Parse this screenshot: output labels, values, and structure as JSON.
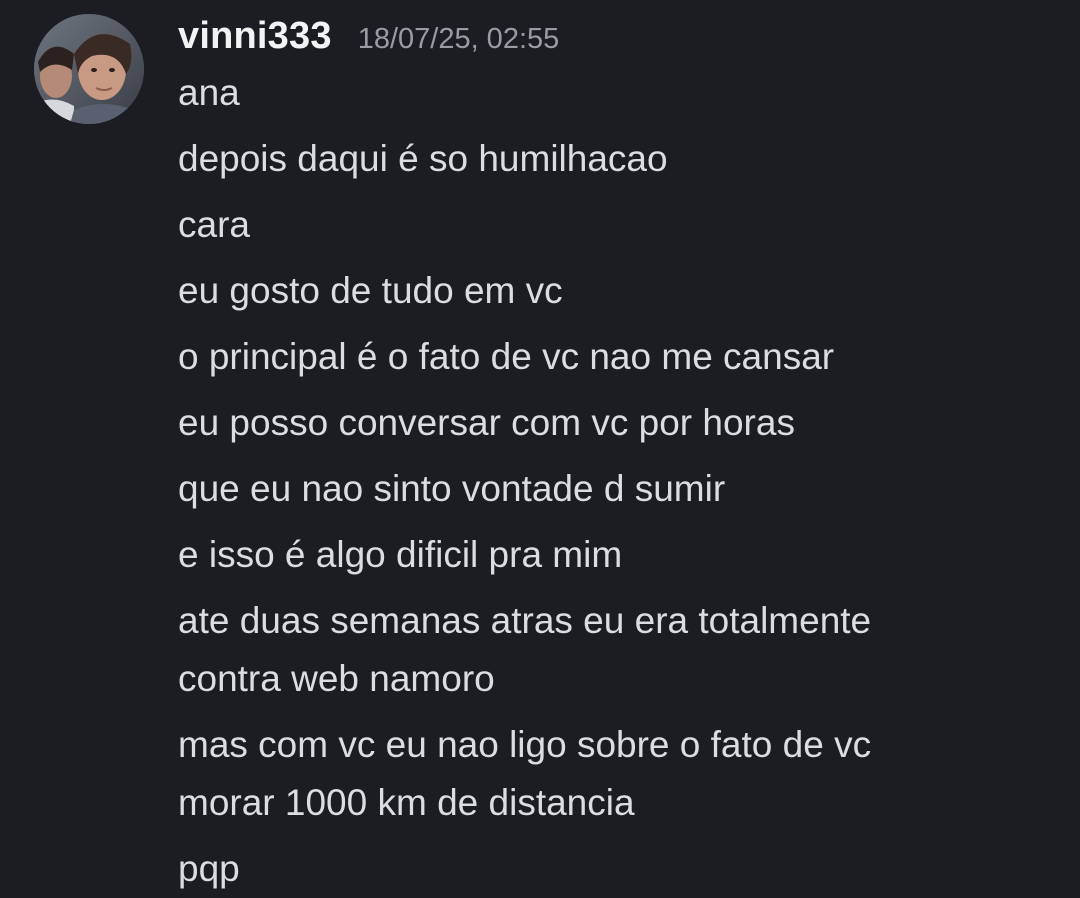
{
  "author": {
    "username": "vinni333",
    "timestamp": "18/07/25, 02:55",
    "avatar_icon": "profile-photo-avatar"
  },
  "messages": [
    {
      "lines": [
        "ana"
      ]
    },
    {
      "lines": [
        "depois daqui é so humilhacao"
      ]
    },
    {
      "lines": [
        "cara"
      ]
    },
    {
      "lines": [
        "eu gosto de tudo em vc"
      ]
    },
    {
      "lines": [
        "o principal é o fato de vc nao me cansar"
      ]
    },
    {
      "lines": [
        "eu posso conversar com vc por horas"
      ]
    },
    {
      "lines": [
        "que eu nao sinto vontade d sumir"
      ]
    },
    {
      "lines": [
        "e isso é algo dificil pra mim"
      ]
    },
    {
      "lines": [
        "ate duas semanas atras eu era totalmente",
        "contra web namoro"
      ]
    },
    {
      "lines": [
        "mas com vc eu nao ligo sobre o fato de vc",
        "morar 1000 km de distancia"
      ]
    },
    {
      "lines": [
        "pqp"
      ]
    }
  ],
  "colors": {
    "background": "#1c1d22",
    "username": "#f2f3f5",
    "timestamp": "#9a9ca3",
    "message_text": "#dcdde1"
  }
}
